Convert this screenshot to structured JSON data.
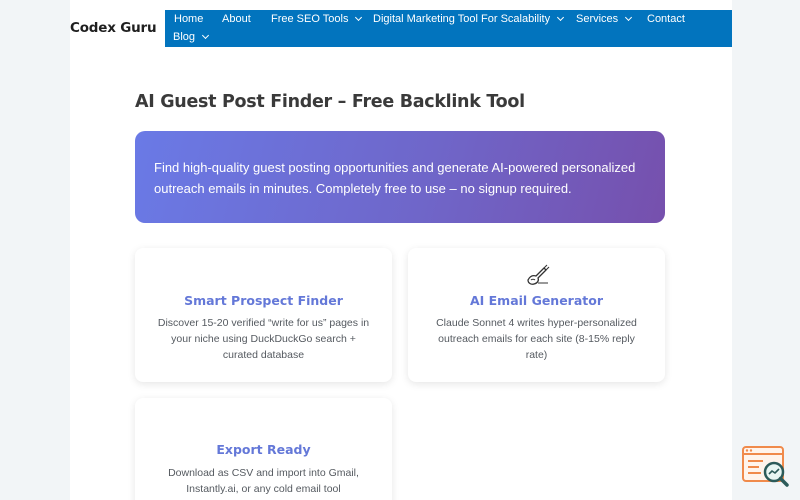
{
  "site": {
    "logo": "Codex Guru"
  },
  "nav": {
    "items": [
      {
        "label": "Home",
        "dropdown": false
      },
      {
        "label": "About",
        "dropdown": false
      },
      {
        "label": "Free SEO Tools",
        "dropdown": true
      },
      {
        "label": "Digital Marketing Tool For Scalability",
        "dropdown": true
      },
      {
        "label": "Services",
        "dropdown": true
      },
      {
        "label": "Contact",
        "dropdown": false
      },
      {
        "label": "Blog",
        "dropdown": true
      }
    ]
  },
  "page": {
    "title": "AI Guest Post Finder – Free Backlink Tool",
    "hero_line1": "Find high-quality guest posting opportunities and generate AI-powered personalized",
    "hero_line2": "outreach emails in minutes. Completely free to use – no signup required."
  },
  "features": [
    {
      "icon": "none",
      "title": "Smart Prospect Finder",
      "desc_lines": [
        "Discover 15-20 verified “write for us” pages in",
        "your niche using DuckDuckGo search +",
        "curated database"
      ]
    },
    {
      "icon": "writing-hand-icon",
      "title": "AI Email Generator",
      "desc_lines": [
        "Claude Sonnet 4 writes hyper-personalized",
        "outreach emails for each site (8-15% reply",
        "rate)"
      ]
    },
    {
      "icon": "none",
      "title": "Export Ready",
      "desc_lines": [
        "Download as CSV and import into Gmail,",
        "Instantly.ai, or any cold email tool"
      ]
    }
  ],
  "colors": {
    "nav_bg": "#0274be",
    "accent": "#6478d8",
    "hero_gradient_start": "#6a7ae6",
    "hero_gradient_end": "#7650ad"
  },
  "floating_widget": {
    "icon": "seo-search-widget-icon"
  }
}
